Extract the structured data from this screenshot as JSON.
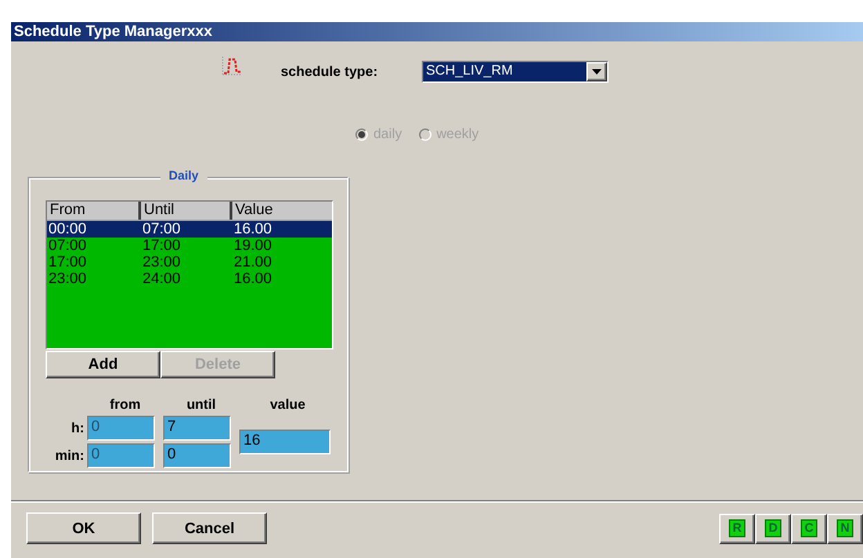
{
  "window": {
    "title": "Schedule Type Managerxxx"
  },
  "schedule_type": {
    "label": "schedule type:",
    "value": "SCH_LIV_RM"
  },
  "mode": [
    {
      "label": "daily",
      "selected": true,
      "disabled": true
    },
    {
      "label": "weekly",
      "selected": false,
      "disabled": true
    }
  ],
  "daily": {
    "title": "Daily",
    "columns": [
      "From",
      "Until",
      "Value"
    ],
    "rows": [
      {
        "cells": [
          "00:00",
          "07:00",
          "16.00"
        ],
        "selected": true
      },
      {
        "cells": [
          "07:00",
          "17:00",
          "19.00"
        ],
        "selected": false
      },
      {
        "cells": [
          "17:00",
          "23:00",
          "21.00"
        ],
        "selected": false
      },
      {
        "cells": [
          "23:00",
          "24:00",
          "16.00"
        ],
        "selected": false
      }
    ],
    "buttons": [
      {
        "label": "Add",
        "disabled": false
      },
      {
        "label": "Delete",
        "disabled": true
      }
    ],
    "editor": {
      "columns": [
        "from",
        "until",
        "value"
      ],
      "row_labels": [
        "h:",
        "min:"
      ],
      "from": {
        "h": "0",
        "min": "0",
        "disabled": true
      },
      "until": {
        "h": "7",
        "min": "0",
        "disabled": false
      },
      "value": "16"
    }
  },
  "footer": {
    "buttons": [
      "OK",
      "Cancel"
    ],
    "tools": [
      "R",
      "D",
      "C",
      "N"
    ]
  }
}
